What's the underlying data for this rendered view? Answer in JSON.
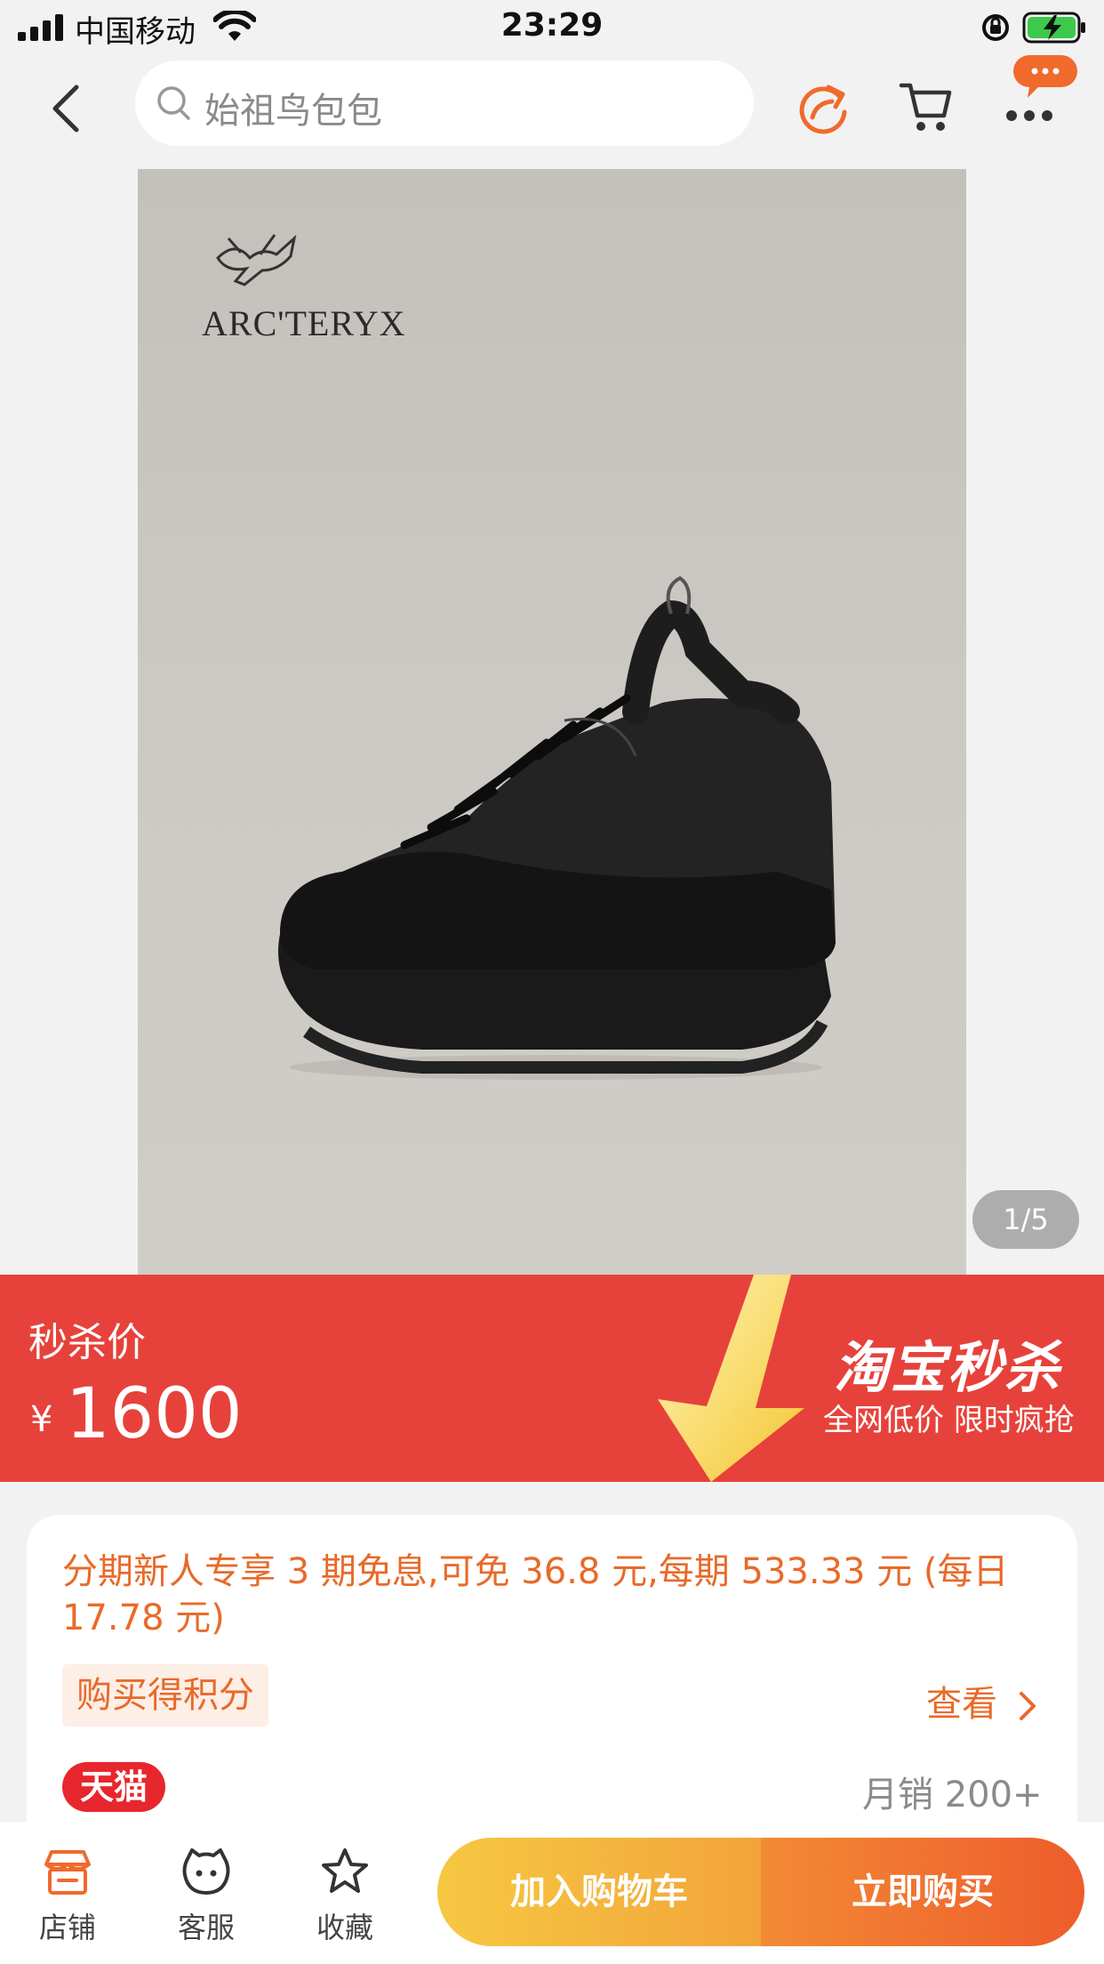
{
  "status_bar": {
    "carrier": "中国移动",
    "time": "23:29"
  },
  "nav": {
    "search_placeholder": "始祖鸟包包"
  },
  "gallery": {
    "logo_text": "ARC'TERYX",
    "pager": "1/5"
  },
  "flash_sale": {
    "label": "秒杀价",
    "currency": "¥",
    "price": "1600",
    "brand": "淘宝秒杀",
    "slogan": "全网低价 限时疯抢"
  },
  "info": {
    "installment": "分期新人专享 3 期免息,可免 36.8 元,每期 533.33 元 (每日 17.78 元)",
    "points_tag": "购买得积分",
    "view_link": "查看",
    "platform_badge": "天猫",
    "monthly_sales": "月销 200+"
  },
  "bottom_bar": {
    "store": "店铺",
    "service": "客服",
    "favorite": "收藏",
    "add_to_cart": "加入购物车",
    "buy_now": "立即购买"
  },
  "colors": {
    "accent_orange": "#e86a2a",
    "flash_red": "#e6423b",
    "tmall_red": "#e8262d"
  }
}
